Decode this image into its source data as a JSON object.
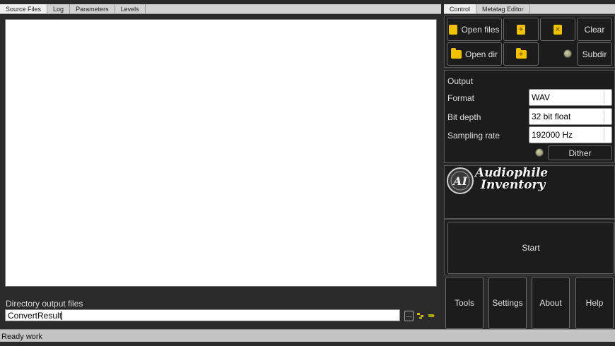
{
  "left_tabs": [
    "Source Files",
    "Log",
    "Parameters",
    "Levels"
  ],
  "right_tabs": [
    "Control",
    "Metatag Editor"
  ],
  "output_dir": {
    "label": "Directory output files",
    "value": "ConvertResult",
    "browse_label": "..."
  },
  "status": "Ready work",
  "controls": {
    "open_files": "Open files",
    "clear": "Clear",
    "open_dir": "Open dir",
    "subdir": "Subdir"
  },
  "output": {
    "heading": "Output",
    "format_label": "Format",
    "format_value": "WAV",
    "bitdepth_label": "Bit depth",
    "bitdepth_value": "32 bit float",
    "rate_label": "Sampling rate",
    "rate_value": "192000 Hz",
    "dither": "Dither"
  },
  "logo": {
    "monogram": "AI",
    "line1": "Audiophile",
    "line2": "Inventory"
  },
  "start": "Start",
  "bottom_buttons": [
    "Tools",
    "Settings",
    "About",
    "Help"
  ],
  "colors": {
    "background": "#2a2a2a",
    "panel": "#1c1c1c",
    "accent_yellow": "#f2c200"
  }
}
